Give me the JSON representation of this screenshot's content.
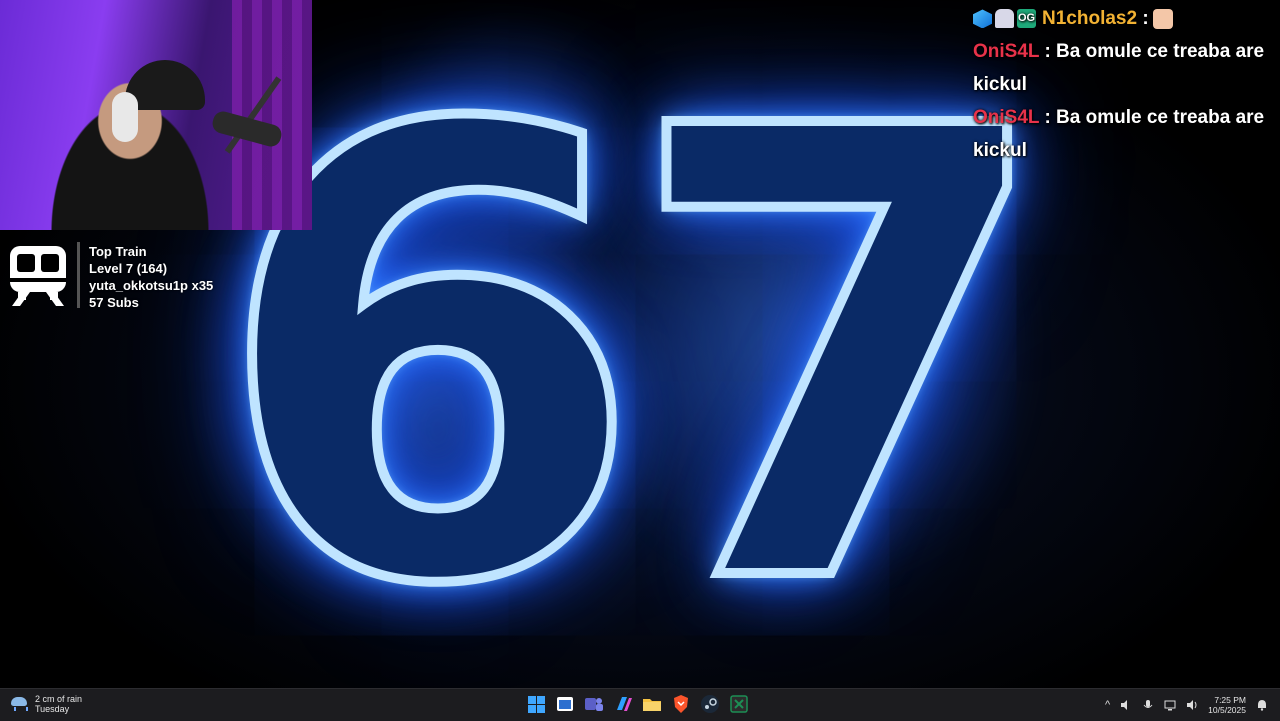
{
  "overlay": {
    "big_number": "67"
  },
  "top_train": {
    "title": "Top Train",
    "level": "Level 7  (164)",
    "top_user": "yuta_okkotsu1p x35",
    "subs": "57 Subs"
  },
  "chat": {
    "messages": [
      {
        "user": "N1cholas2",
        "sep": " :",
        "text": "",
        "badges": [
          "cube-badge-icon",
          "robot-badge-icon",
          "og-badge-icon"
        ],
        "user_color": "#f2b233",
        "emote": "cat-emote-icon"
      },
      {
        "user": "OniS4L",
        "sep": " :",
        "text": " Ba omule ce treaba are kickul",
        "user_color": "#e8324a"
      },
      {
        "user": "OniS4L",
        "sep": " :",
        "text": " Ba omule ce treaba are kickul",
        "user_color": "#e8324a"
      }
    ]
  },
  "taskbar": {
    "weather_line1": "2 cm of rain",
    "weather_line2": "Tuesday",
    "time": "7:25 PM",
    "date": "10/5/2025",
    "pinned_apps": [
      "windows-start-icon",
      "terminal-icon",
      "teams-icon",
      "copilot-icon",
      "file-explorer-icon",
      "brave-browser-icon",
      "steam-icon",
      "excel-icon"
    ]
  }
}
